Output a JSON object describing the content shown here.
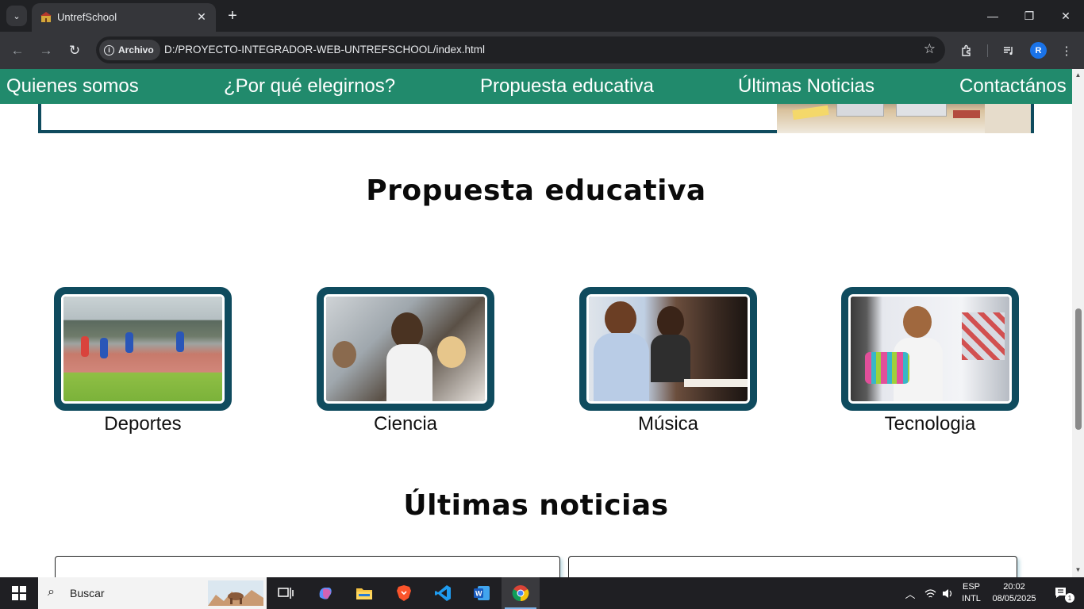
{
  "browser": {
    "tab_title": "UntrefSchool",
    "omnibox_chip": "Archivo",
    "url": "D:/PROYECTO-INTEGRADOR-WEB-UNTREFSCHOOL/index.html",
    "profile_initial": "R"
  },
  "site_nav": {
    "items": [
      {
        "label": "Quienes somos"
      },
      {
        "label": "¿Por qué elegirnos?"
      },
      {
        "label": "Propuesta educativa"
      },
      {
        "label": "Últimas Noticias"
      },
      {
        "label": "Contactános"
      }
    ],
    "bg_color": "#218a6c"
  },
  "propuesta": {
    "title": "Propuesta educativa",
    "cards": [
      {
        "label": "Deportes",
        "image": "students-running-track"
      },
      {
        "label": "Ciencia",
        "image": "science-class-experiment"
      },
      {
        "label": "Música",
        "image": "piano-lesson"
      },
      {
        "label": "Tecnologia",
        "image": "boy-with-robot"
      }
    ],
    "card_border_color": "#0f4b5e"
  },
  "noticias": {
    "title": "Últimas noticias"
  },
  "taskbar": {
    "search_placeholder": "Buscar",
    "language": "ESP",
    "layout": "INTL",
    "time": "20:02",
    "date": "08/05/2025",
    "notification_count": "1"
  }
}
